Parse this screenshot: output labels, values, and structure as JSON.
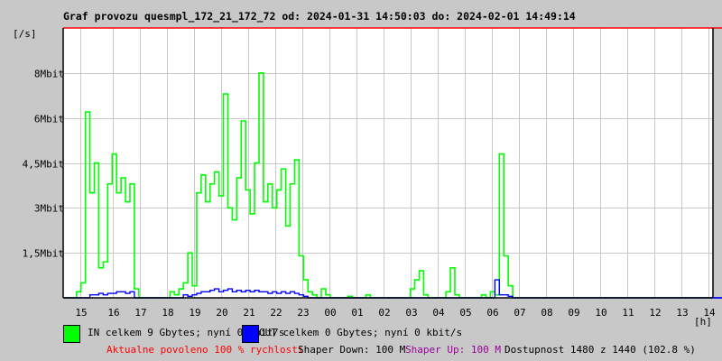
{
  "title": "Graf provozu quesmpl_172_21_172_72 od: 2024-01-31 14:50:03 do: 2024-02-01 14:49:14",
  "chart_data": {
    "type": "line",
    "title": "Graf provozu quesmpl_172_21_172_72 od: 2024-01-31 14:50:03 do: 2024-02-01 14:49:14",
    "ylabel": "[/s]",
    "xlabel": "[h]",
    "ylim": [
      0,
      9
    ],
    "y_unit": "Mbit/s",
    "y_ticks": [
      {
        "value": 1.5,
        "label": "1,5Mbit"
      },
      {
        "value": 3,
        "label": "3Mbit"
      },
      {
        "value": 4.5,
        "label": "4,5Mbit"
      },
      {
        "value": 6,
        "label": "6Mbit"
      },
      {
        "value": 7.5,
        "label": "8Mbit"
      }
    ],
    "x_tick_labels": [
      "15",
      "16",
      "17",
      "18",
      "19",
      "20",
      "21",
      "22",
      "23",
      "00",
      "01",
      "02",
      "03",
      "04",
      "05",
      "06",
      "07",
      "08",
      "09",
      "10",
      "11",
      "12",
      "13",
      "14"
    ],
    "sample_interval_minutes": 10,
    "grid": true,
    "series": [
      {
        "name": "IN",
        "color": "#00ff00",
        "values": [
          0,
          0,
          0,
          0.2,
          0.5,
          6.2,
          3.5,
          4.5,
          1,
          1.2,
          3.8,
          4.8,
          3.5,
          4,
          3.2,
          3.8,
          0.3,
          0,
          0,
          0,
          0,
          0,
          0,
          0,
          0.2,
          0.1,
          0.3,
          0.5,
          1.5,
          0.4,
          3.5,
          4.1,
          3.2,
          3.8,
          4.2,
          3.4,
          6.8,
          3.0,
          2.6,
          4.0,
          5.9,
          3.6,
          2.8,
          4.5,
          7.5,
          3.2,
          3.8,
          3.0,
          3.6,
          4.3,
          2.4,
          3.8,
          4.6,
          1.4,
          0.6,
          0.2,
          0.1,
          0,
          0.3,
          0.1,
          0,
          0,
          0,
          0,
          0.05,
          0,
          0,
          0,
          0.1,
          0,
          0,
          0,
          0,
          0,
          0,
          0,
          0,
          0,
          0.3,
          0.6,
          0.9,
          0.1,
          0,
          0,
          0,
          0,
          0.2,
          1.0,
          0.1,
          0,
          0,
          0,
          0,
          0,
          0.1,
          0,
          0.2,
          0.1,
          4.8,
          1.4,
          0.4,
          0,
          0,
          0,
          0,
          0,
          0,
          0,
          0,
          0,
          0,
          0,
          0,
          0,
          0,
          0,
          0,
          0,
          0,
          0,
          0,
          0,
          0,
          0,
          0,
          0,
          0,
          0,
          0,
          0,
          0,
          0,
          0,
          0,
          0,
          0,
          0,
          0,
          0,
          0,
          0,
          0,
          0,
          0,
          0,
          0
        ]
      },
      {
        "name": "OUT",
        "color": "#0000ff",
        "values": [
          0,
          0,
          0,
          0,
          0,
          0,
          0.1,
          0.1,
          0.15,
          0.1,
          0.15,
          0.15,
          0.2,
          0.2,
          0.15,
          0.2,
          0,
          0,
          0,
          0,
          0,
          0,
          0,
          0,
          0,
          0,
          0,
          0.1,
          0.05,
          0.1,
          0.15,
          0.2,
          0.2,
          0.25,
          0.3,
          0.2,
          0.25,
          0.3,
          0.2,
          0.25,
          0.2,
          0.25,
          0.2,
          0.25,
          0.2,
          0.2,
          0.15,
          0.2,
          0.15,
          0.2,
          0.15,
          0.2,
          0.15,
          0.1,
          0.05,
          0,
          0,
          0,
          0,
          0,
          0,
          0,
          0,
          0,
          0,
          0,
          0,
          0,
          0,
          0,
          0,
          0,
          0,
          0,
          0,
          0,
          0,
          0,
          0,
          0,
          0,
          0,
          0,
          0,
          0,
          0,
          0,
          0,
          0,
          0,
          0,
          0,
          0,
          0,
          0,
          0,
          0,
          0.6,
          0.1,
          0.1,
          0.05,
          0,
          0,
          0,
          0,
          0,
          0,
          0,
          0,
          0,
          0,
          0,
          0,
          0,
          0,
          0,
          0,
          0,
          0,
          0,
          0,
          0,
          0,
          0,
          0,
          0,
          0,
          0,
          0,
          0,
          0,
          0,
          0,
          0,
          0,
          0,
          0,
          0,
          0,
          0,
          0,
          0,
          0,
          0,
          0,
          0,
          0,
          0,
          0
        ]
      }
    ],
    "max_line_color": "#ff0000"
  },
  "legend": {
    "in_color": "#00ff00",
    "in_text": "IN celkem 9 Gbytes; nyní 0 Mbit/s",
    "out_color": "#0000ff",
    "out_text": "OUT celkem 0 Gbytes; nyní 0 kbit/s"
  },
  "footer": {
    "allowed": "Aktualne povoleno 100 % rychlosti",
    "allowed_color": "#ff0000",
    "shaper_down": "Shaper Down: 100 M",
    "shaper_up": "Shaper Up: 100 M",
    "shaper_up_color": "#990099",
    "availability": "Dostupnost 1480 z 1440 (102.8 %)"
  }
}
